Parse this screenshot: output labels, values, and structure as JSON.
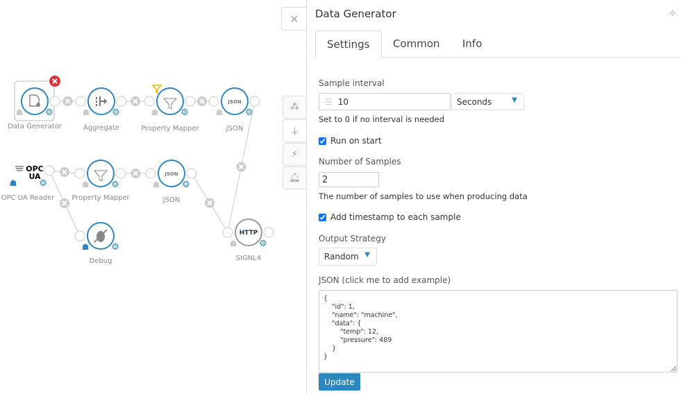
{
  "flow": {
    "nodes": [
      {
        "id": "dg",
        "label": "Data Generator",
        "icon": "data-generator-icon",
        "selected": true,
        "debug_active": false
      },
      {
        "id": "agg",
        "label": "Aggregate",
        "icon": "aggregate-icon",
        "debug_active": false
      },
      {
        "id": "pm1",
        "label": "Property Mapper",
        "icon": "funnel-icon",
        "debug_active": false,
        "filter_badge": true
      },
      {
        "id": "json1",
        "label": "JSON",
        "icon_text": "JSON",
        "debug_active": false
      },
      {
        "id": "opc",
        "label": "OPC UA Reader",
        "icon_text": "OPC UA",
        "debug_active": true
      },
      {
        "id": "pm2",
        "label": "Property Mapper",
        "icon": "funnel-icon",
        "debug_active": false
      },
      {
        "id": "json2",
        "label": "JSON",
        "icon_text": "JSON",
        "debug_active": false
      },
      {
        "id": "debug",
        "label": "Debug",
        "icon": "debug-off-icon",
        "debug_active": true
      },
      {
        "id": "http",
        "label": "SIGNL4",
        "icon_text": "HTTP",
        "debug_active": false
      }
    ],
    "connections": [
      [
        "dg",
        "agg"
      ],
      [
        "agg",
        "pm1"
      ],
      [
        "pm1",
        "json1"
      ],
      [
        "json1",
        "http"
      ],
      [
        "opc",
        "pm2"
      ],
      [
        "opc",
        "debug"
      ],
      [
        "pm2",
        "json2"
      ],
      [
        "json2",
        "http"
      ]
    ]
  },
  "sidebar_tools": [
    "flow-icon",
    "plug-icon",
    "magic-icon",
    "bell-icon"
  ],
  "panel": {
    "title": "Data Generator",
    "tabs": [
      {
        "label": "Settings",
        "active": true
      },
      {
        "label": "Common"
      },
      {
        "label": "Info"
      }
    ],
    "sample_interval_label": "Sample interval",
    "sample_interval_value": "10",
    "interval_unit": "Seconds",
    "interval_hint": "Set to 0 if no interval is needed",
    "run_on_start_label": "Run on start",
    "run_on_start": true,
    "num_samples_label": "Number of Samples",
    "num_samples_value": "2",
    "num_samples_hint": "The number of samples to use when producing data",
    "add_timestamp_label": "Add timestamp to each sample",
    "add_timestamp": true,
    "output_strategy_label": "Output Strategy",
    "output_strategy": "Random",
    "json_label": "JSON (click me to add example)",
    "json_value": "{\n\t\"id\": 1,\n\t\"name\": \"machine\",\n\t\"data\": {\n\t\t\"temp\": 12,\n\t\t\"pressure\": 489\n\t}\n}",
    "update_label": "Update"
  },
  "colors": {
    "accent": "#2e86c1",
    "delete": "#d9363e",
    "filter": "#e6b800"
  }
}
